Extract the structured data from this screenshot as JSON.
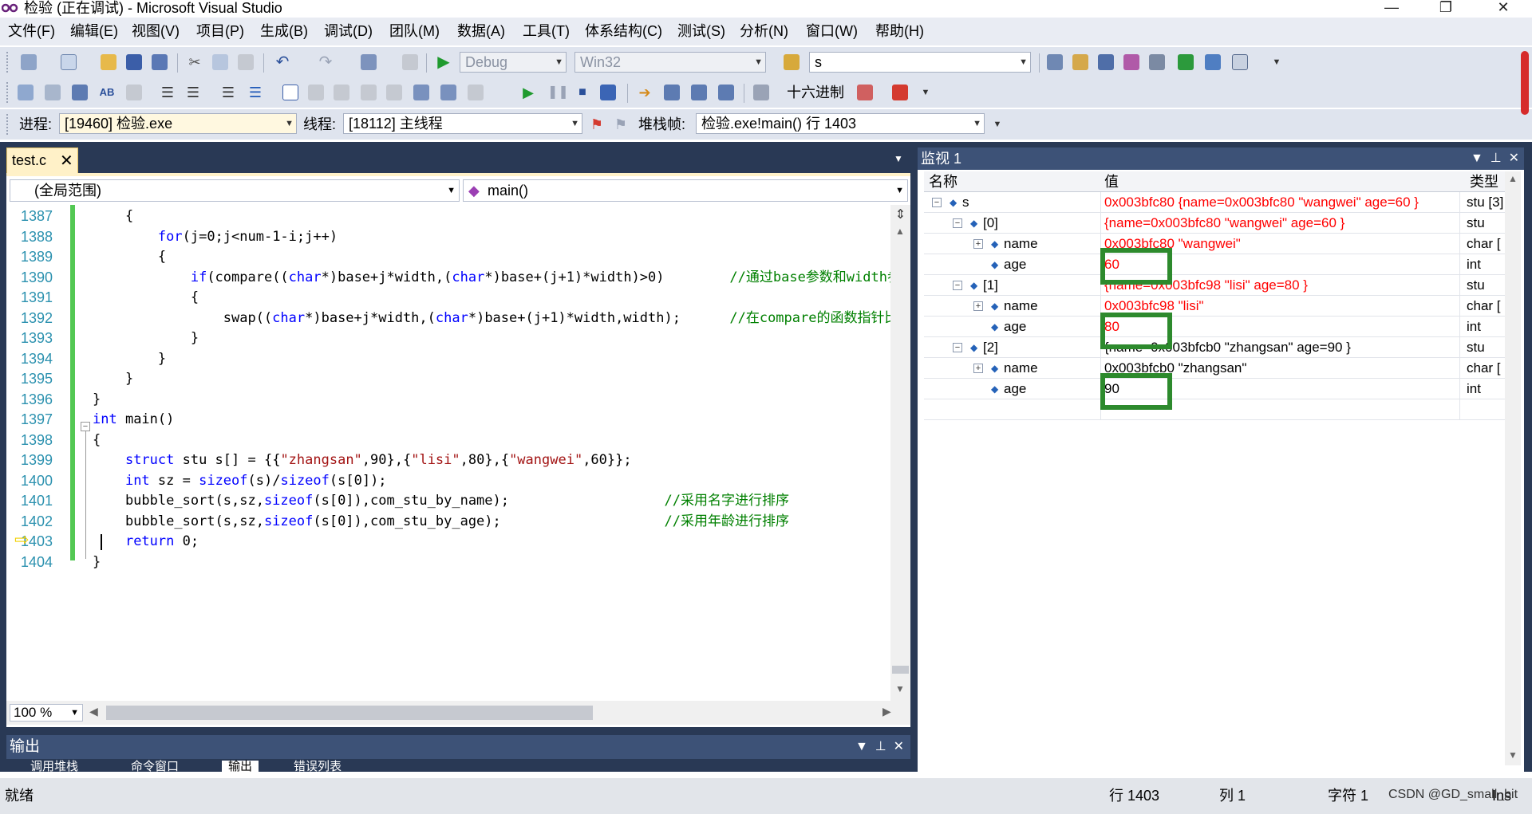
{
  "window": {
    "title": "检验 (正在调试) - Microsoft Visual Studio",
    "buttons": [
      "—",
      "❐",
      "✕"
    ]
  },
  "menu": [
    "文件(F)",
    "编辑(E)",
    "视图(V)",
    "项目(P)",
    "生成(B)",
    "调试(D)",
    "团队(M)",
    "数据(A)",
    "工具(T)",
    "体系结构(C)",
    "测试(S)",
    "分析(N)",
    "窗口(W)",
    "帮助(H)"
  ],
  "toolbar1": {
    "config": "Debug",
    "platform": "Win32",
    "find_value": "s"
  },
  "toolbar2": {
    "hex_label": "十六进制"
  },
  "toolbar3": {
    "process_label": "进程:",
    "process_value": "[19460] 检验.exe",
    "thread_label": "线程:",
    "thread_value": "[18112] 主线程",
    "stack_label": "堆栈帧:",
    "stack_value": "检验.exe!main()  行 1403"
  },
  "editor": {
    "tab": "test.c",
    "tab_close": "✕",
    "scope": "(全局范围)",
    "function": "main()",
    "zoom": "100 %",
    "lines": [
      {
        "n": "1387",
        "code": "    {"
      },
      {
        "n": "1388",
        "code": "        for(j=0;j<num-1-i;j++)"
      },
      {
        "n": "1389",
        "code": "        {"
      },
      {
        "n": "1390",
        "code": "            if(compare((char*)base+j*width,(char*)base+(j+1)*width)>0)        //通过base参数和width参"
      },
      {
        "n": "1391",
        "code": "            {"
      },
      {
        "n": "1392",
        "code": "                swap((char*)base+j*width,(char*)base+(j+1)*width,width);      //在compare的函数指针比"
      },
      {
        "n": "1393",
        "code": "            }"
      },
      {
        "n": "1394",
        "code": "        }"
      },
      {
        "n": "1395",
        "code": "    }"
      },
      {
        "n": "1396",
        "code": "}"
      },
      {
        "n": "1397",
        "code": "int main()"
      },
      {
        "n": "1398",
        "code": "{"
      },
      {
        "n": "1399",
        "code": "    struct stu s[] = {{\"zhangsan\",90},{\"lisi\",80},{\"wangwei\",60}};"
      },
      {
        "n": "1400",
        "code": "    int sz = sizeof(s)/sizeof(s[0]);"
      },
      {
        "n": "1401",
        "code": "    bubble_sort(s,sz,sizeof(s[0]),com_stu_by_name);                   //采用名字进行排序"
      },
      {
        "n": "1402",
        "code": "    bubble_sort(s,sz,sizeof(s[0]),com_stu_by_age);                    //采用年龄进行排序"
      },
      {
        "n": "1403",
        "code": "    return 0;"
      },
      {
        "n": "1404",
        "code": "}"
      }
    ]
  },
  "watch": {
    "title": "监视 1",
    "cols": {
      "name": "名称",
      "value": "值",
      "type": "类型"
    },
    "rows": [
      {
        "name": "s",
        "value": "0x003bfc80 {name=0x003bfc80 \"wangwei\" age=60 }",
        "type": "stu [3]",
        "indent": 0,
        "toggle": "⊟",
        "red": true
      },
      {
        "name": "[0]",
        "value": "{name=0x003bfc80 \"wangwei\" age=60 }",
        "type": "stu",
        "indent": 1,
        "toggle": "⊟",
        "red": true
      },
      {
        "name": "name",
        "value": "0x003bfc80 \"wangwei\"",
        "type": "char [",
        "indent": 2,
        "toggle": "⊞",
        "red": true
      },
      {
        "name": "age",
        "value": "60",
        "type": "int",
        "indent": 2,
        "toggle": "",
        "red": true
      },
      {
        "name": "[1]",
        "value": "{name=0x003bfc98 \"lisi\" age=80 }",
        "type": "stu",
        "indent": 1,
        "toggle": "⊟",
        "red": true
      },
      {
        "name": "name",
        "value": "0x003bfc98 \"lisi\"",
        "type": "char [",
        "indent": 2,
        "toggle": "⊞",
        "red": true
      },
      {
        "name": "age",
        "value": "80",
        "type": "int",
        "indent": 2,
        "toggle": "",
        "red": true
      },
      {
        "name": "[2]",
        "value": "{name=0x003bfcb0 \"zhangsan\" age=90 }",
        "type": "stu",
        "indent": 1,
        "toggle": "⊟",
        "red": false
      },
      {
        "name": "name",
        "value": "0x003bfcb0 \"zhangsan\"",
        "type": "char [",
        "indent": 2,
        "toggle": "⊞",
        "red": false
      },
      {
        "name": "age",
        "value": "90",
        "type": "int",
        "indent": 2,
        "toggle": "",
        "red": false
      }
    ]
  },
  "output": {
    "title": "输出",
    "tabs": [
      "调用堆栈",
      "命令窗口",
      "输出",
      "错误列表"
    ]
  },
  "status": {
    "ready": "就绪",
    "row": "行 1403",
    "col": "列 1",
    "char": "字符 1",
    "mode": "Ins"
  },
  "watermark": "CSDN @GD_small_bit",
  "colors": {
    "accent_blue": "#293955",
    "panel_header": "#3d5277",
    "highlight_box": "#2d8a2d",
    "changed_value": "#ff0000"
  }
}
